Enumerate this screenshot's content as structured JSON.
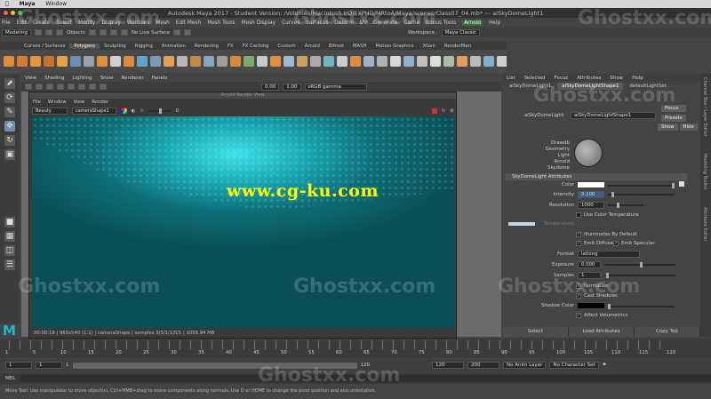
{
  "mac": {
    "app": "Maya",
    "window": "Window"
  },
  "title": "Autodesk Maya 2017 - Student Version: /Volumes/Macintosh HD/FXPHD/MRtoA/Maya/scenes/Class07_04.mb* --- aiSkyDomeLight1",
  "menu": [
    "File",
    "Edit",
    "Create",
    "Select",
    "Modify",
    "Display",
    "Windows",
    "Mesh",
    "Edit Mesh",
    "Mesh Tools",
    "Mesh Display",
    "Curves",
    "Surfaces",
    "Deform",
    "UV",
    "Generate",
    "Cache",
    "Bonus Tools",
    "Arnold",
    "Help"
  ],
  "menu_highlight": "Arnold",
  "status": {
    "mode": "Modeling",
    "objects": "Objects",
    "live": "No Live Surface",
    "workspace_label": "Workspace :",
    "workspace": "Maya Classic"
  },
  "shelf_tabs": [
    "Curves / Surfaces",
    "Polygons",
    "Sculpting",
    "Rigging",
    "Animation",
    "Rendering",
    "FX",
    "FX Caching",
    "Custom",
    "Arnold",
    "Bifrost",
    "MASH",
    "Motion Graphics",
    "XGen",
    "RenderMan"
  ],
  "shelf_active": "Polygons",
  "viewport": {
    "menu": [
      "View",
      "Shading",
      "Lighting",
      "Show",
      "Renderer",
      "Panels"
    ],
    "v1": "0.00",
    "v2": "1.00",
    "cs": "sRGB gamma"
  },
  "arv": {
    "title": "Arnold Render View",
    "menu": [
      "File",
      "Window",
      "View",
      "Render"
    ],
    "aov": "Beauty",
    "camera": "cameraShape1",
    "exposure": "0",
    "status": "00:00:19 | 960x540 (1:1) | cameraShape | samples 3/3/1/1/0/1 | 1058.94 MB"
  },
  "watermark": "www.cg-ku.com",
  "ghost": "Ghostxx.com",
  "panel": {
    "menu": [
      "List",
      "Selected",
      "Focus",
      "Attributes",
      "Show",
      "Help"
    ],
    "tabs": [
      "aiSkyDomeLight1",
      "aiSkyDomeLightShape1",
      "defaultLightSet"
    ],
    "tab_active": "aiSkyDomeLightShape1",
    "node_label": "aiSkyDomeLight:",
    "node_value": "aiSkyDomeLightShape1",
    "focus": "Focus",
    "presets": "Presets",
    "show": "Show",
    "hide": "Hide",
    "swatch_text": [
      "Drawdb",
      "Geometry",
      "Light",
      "Arnold",
      "Skydome"
    ],
    "section": "SkyDomeLight Attributes",
    "color": "Color",
    "intensity": "Intensity",
    "intensity_val": "0.100",
    "resolution": "Resolution",
    "resolution_val": "1000",
    "use_temp": "Use Color Temperature",
    "temperature": "Temperature",
    "illum": "Illuminates By Default",
    "emit_diffuse": "Emit Diffuse",
    "emit_specular": "Emit Specular",
    "format": "Format",
    "format_val": "latlong",
    "exposure": "Exposure",
    "exposure_val": "0.000",
    "samples": "Samples",
    "samples_val": "1",
    "normalize": "Normalize",
    "cast": "Cast Shadows",
    "shadow_color": "Shadow Color",
    "affect": "Affect Volumetrics",
    "bottom": [
      "Select",
      "Load Attributes",
      "Copy Tab"
    ],
    "side": [
      "Channel Box / Layer Editor",
      "Modeling Toolkit",
      "Attribute Editor"
    ]
  },
  "timeline": {
    "nums": [
      "1",
      "5",
      "10",
      "15",
      "20",
      "25",
      "30",
      "35",
      "40",
      "45",
      "50",
      "55",
      "60",
      "65",
      "70",
      "75",
      "80",
      "85",
      "90",
      "95",
      "100",
      "105",
      "110",
      "115",
      "120"
    ]
  },
  "range": {
    "start": "1",
    "start2": "1",
    "mid": "1",
    "end": "120",
    "end2": "120",
    "end3": "200",
    "anim": "No Anim Layer",
    "char": "No Character Set"
  },
  "mel": "MEL",
  "help": "Move Tool: Use manipulator to move object(s). Ctrl+MMB+drag to move components along normals. Use D or HOME to change the pivot position and axis orientation.",
  "colors": {
    "accent": "#1fb6c9",
    "render_hot": "#3ee0e8",
    "watermark": "#ffff00"
  }
}
